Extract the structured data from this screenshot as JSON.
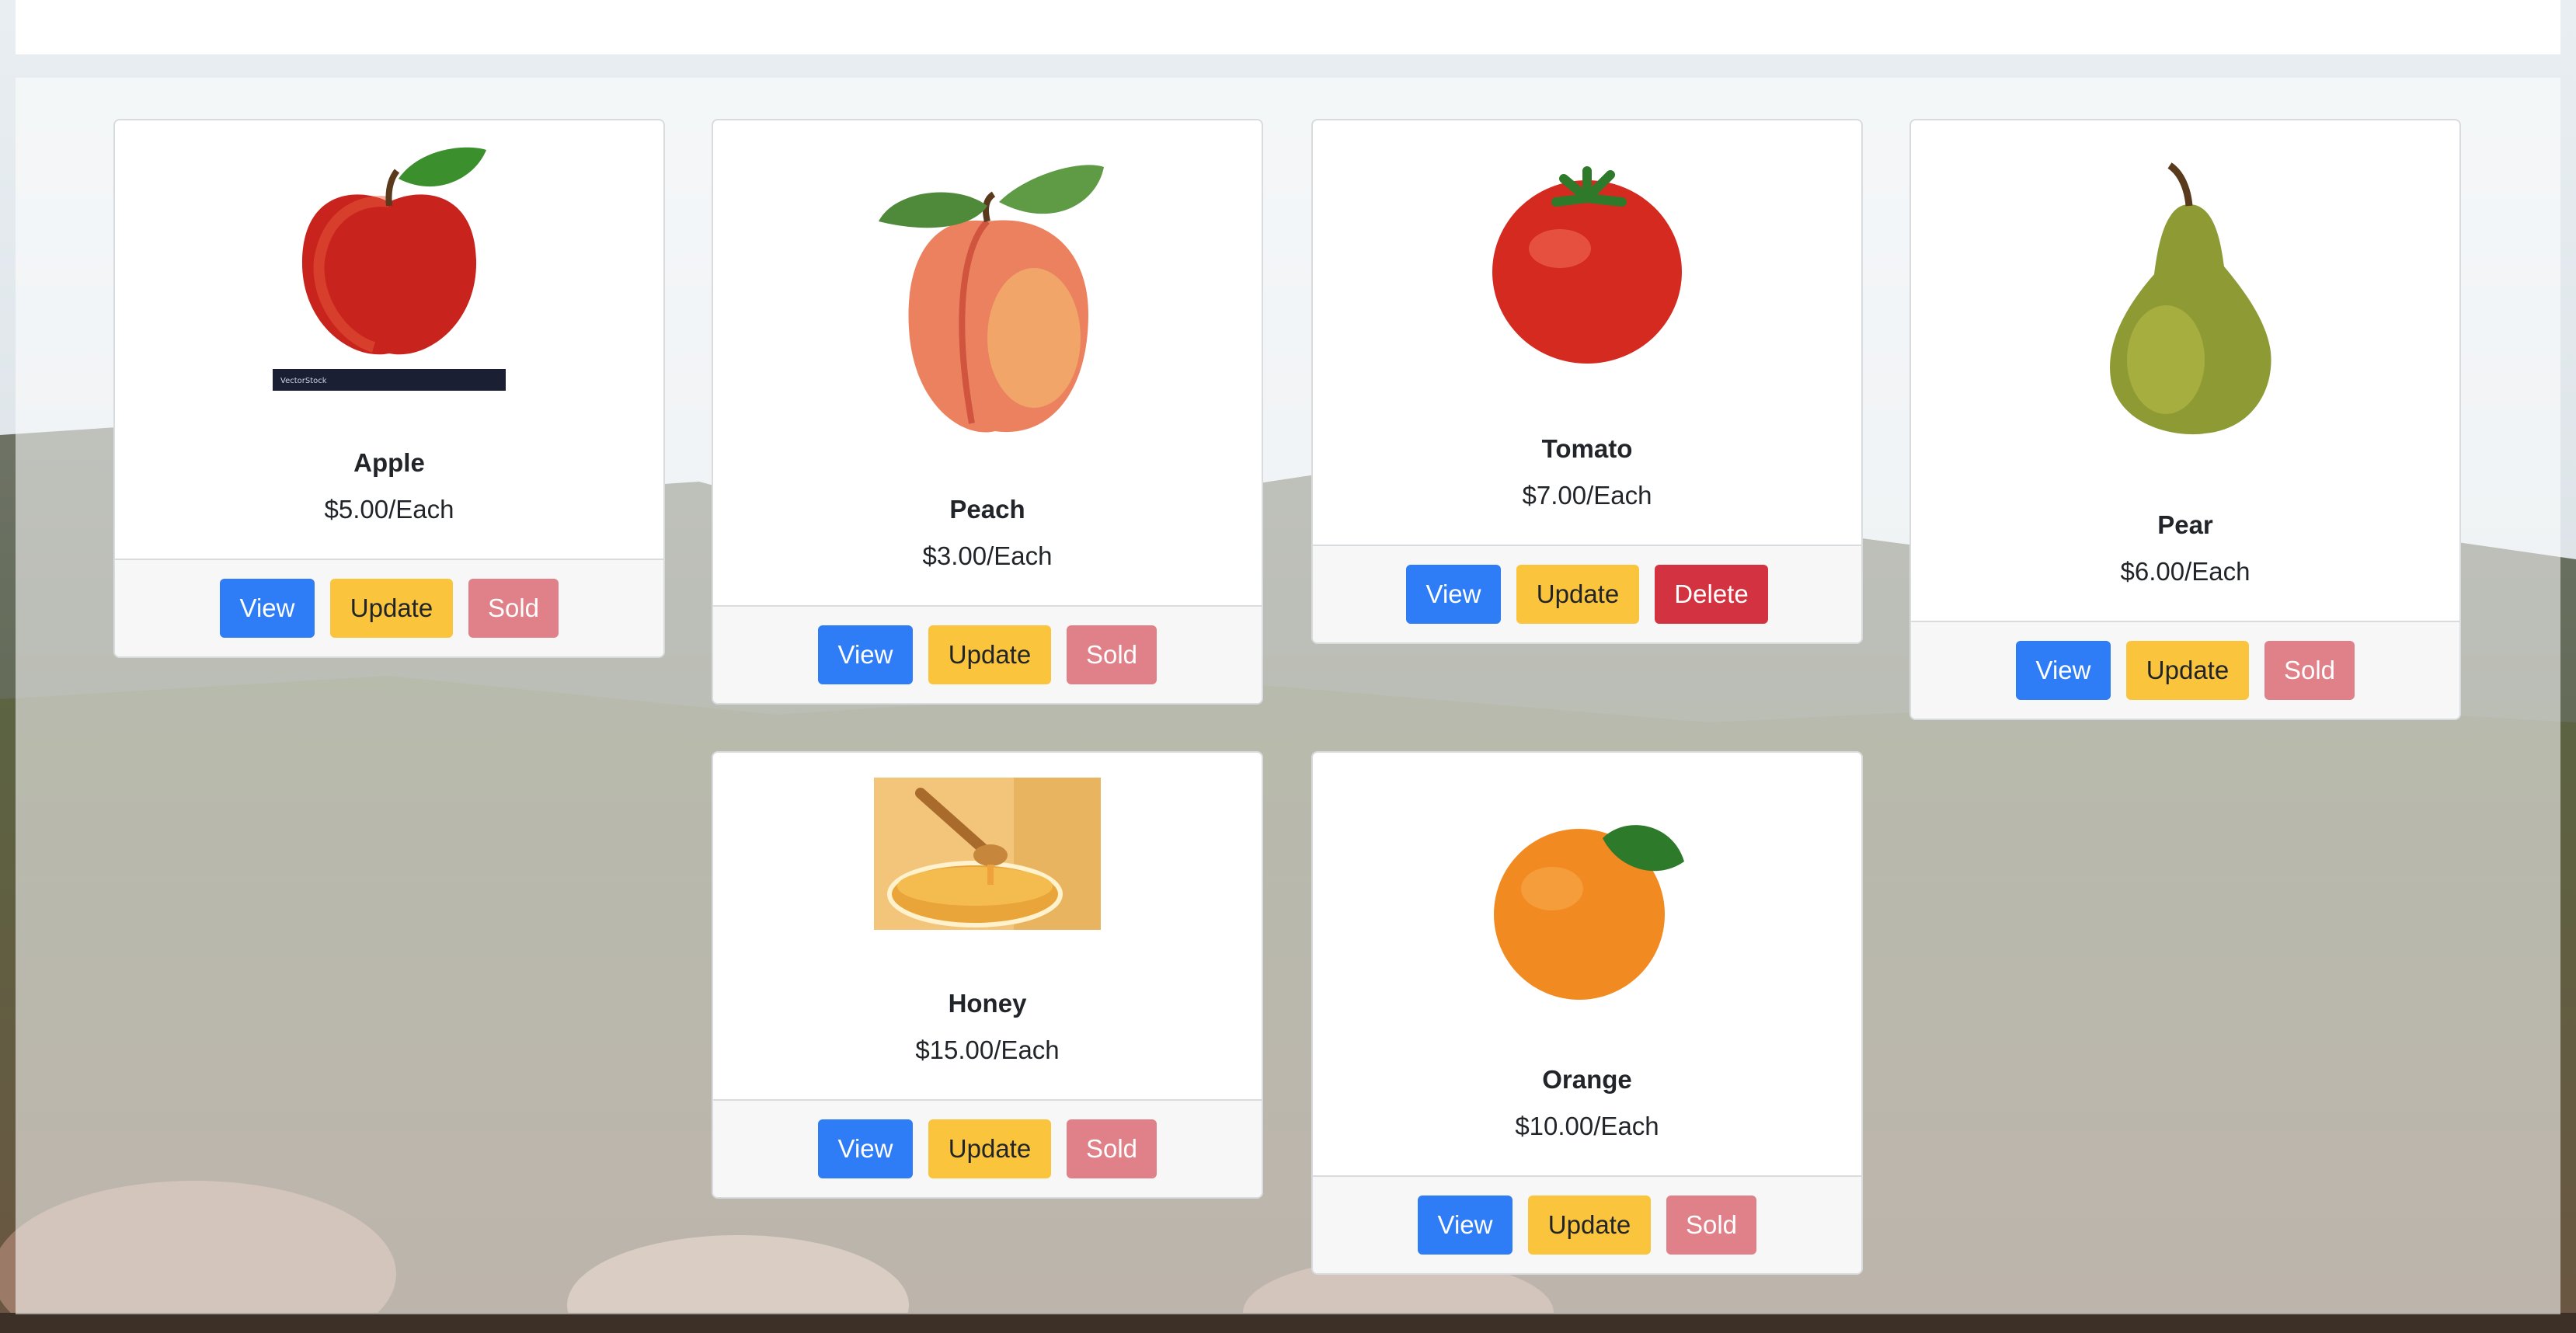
{
  "theme": {
    "primary": "#2f7df6",
    "warning": "#fbc43d",
    "danger": "#d33340",
    "danger_faded": "#e08088"
  },
  "products": [
    {
      "name": "Apple",
      "price": "$5.00/Each",
      "image_icon": "apple-image",
      "buttons": {
        "view": "View",
        "update": "Update",
        "action": "Sold"
      }
    },
    {
      "name": "Peach",
      "price": "$3.00/Each",
      "image_icon": "peach-image",
      "buttons": {
        "view": "View",
        "update": "Update",
        "action": "Sold"
      }
    },
    {
      "name": "Tomato",
      "price": "$7.00/Each",
      "image_icon": "tomato-image",
      "buttons": {
        "view": "View",
        "update": "Update",
        "action": "Delete"
      }
    },
    {
      "name": "Pear",
      "price": "$6.00/Each",
      "image_icon": "pear-image",
      "buttons": {
        "view": "View",
        "update": "Update",
        "action": "Sold"
      }
    },
    {
      "name": "Honey",
      "price": "$15.00/Each",
      "image_icon": "honey-image",
      "buttons": {
        "view": "View",
        "update": "Update",
        "action": "Sold"
      }
    },
    {
      "name": "Orange",
      "price": "$10.00/Each",
      "image_icon": "orange-image",
      "buttons": {
        "view": "View",
        "update": "Update",
        "action": "Sold"
      }
    }
  ]
}
